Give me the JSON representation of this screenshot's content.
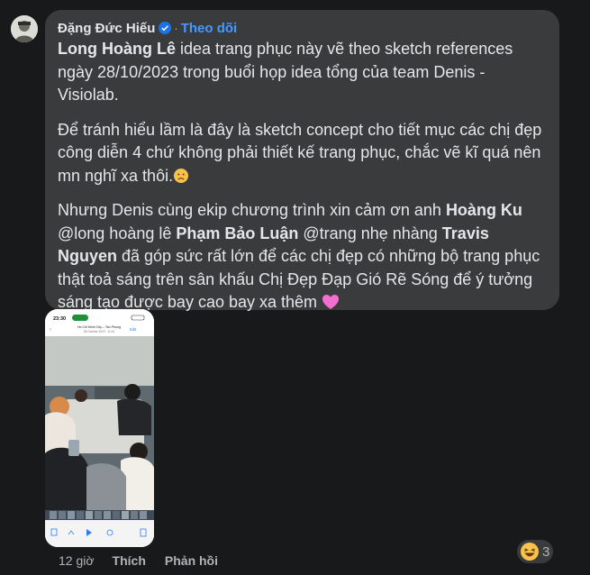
{
  "comment": {
    "author": "Đặng Đức Hiếu",
    "separator": "·",
    "follow_label": "Theo dõi",
    "p1": {
      "mention": "Long Hoàng Lê",
      "text": " idea trang phục này vẽ theo sketch references ngày 28/10/2023 trong buổi họp idea tổng của team Denis - Visiolab."
    },
    "p2": {
      "text": "Để tránh hiểu lầm là đây là sketch concept cho tiết mục các chị đẹp công diễn 4 chứ không phải thiết kế trang phục, chắc vẽ kĩ quá nên mn nghĩ xa thôi."
    },
    "p3": {
      "t1": "Nhưng Denis cùng ekip chương trình xin cảm ơn anh ",
      "m1": "Hoàng Ku",
      "t2": " @long hoàng lê ",
      "m2": "Phạm Bảo Luận",
      "t3": " @trang nhẹ nhàng ",
      "m3": "Travis Nguyen",
      "t4": " đã góp sức rất lớn để các chị đẹp có những bộ trang phục thật toả sáng trên sân khấu Chị Đẹp Đạp Gió Rẽ Sóng để ý tưởng sáng tạo được bay cao bay xa thêm "
    }
  },
  "photo": {
    "status_time": "23:30",
    "location": "Ho Chi Minh City – Tan Phong",
    "date": "28 October 2023 · 11:04",
    "edit_label": "Edit"
  },
  "actions": {
    "time": "12 giờ",
    "like_label": "Thích",
    "reply_label": "Phản hồi"
  },
  "reactions": {
    "icon": "laughing-emoji-icon",
    "count": "3"
  },
  "colors": {
    "background": "#18191a",
    "bubble": "#3a3b3c",
    "text": "#e4e6eb",
    "secondary": "#b0b3b8",
    "link": "#4599ff"
  }
}
